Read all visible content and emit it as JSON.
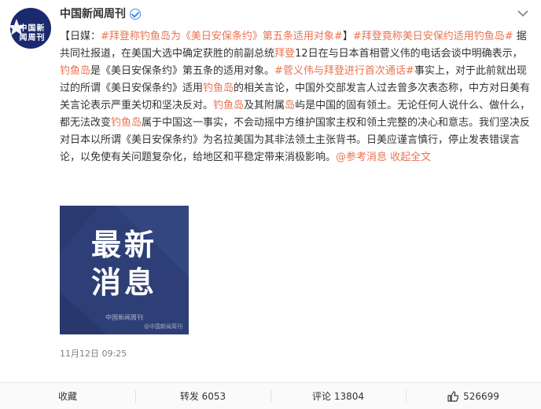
{
  "author": {
    "name": "中国新闻周刊",
    "avatar_text": "中国新闻周刊"
  },
  "post": {
    "segments": [
      {
        "text": "【日媒：",
        "style": "plain"
      },
      {
        "text": "#拜登称钓鱼岛为《美日安保条约》第五条适用对象#",
        "style": "tag"
      },
      {
        "text": "】",
        "style": "plain"
      },
      {
        "text": "#拜登竟称美日安保约适用钓鱼岛#",
        "style": "tag"
      },
      {
        "text": " 据共同社报道，在美国大选中确定获胜的前副总统",
        "style": "plain"
      },
      {
        "text": "拜登",
        "style": "hl"
      },
      {
        "text": "12日在与日本首相菅义伟的电话会谈中明确表示，",
        "style": "plain"
      },
      {
        "text": "钓鱼岛",
        "style": "hl"
      },
      {
        "text": "是《美日安保条约》第五条的适用对象。",
        "style": "plain"
      },
      {
        "text": "#菅义伟与拜登进行首次通话#",
        "style": "tag"
      },
      {
        "text": "事实上，对于此前就出现过的所谓《美日安保条约》适用",
        "style": "plain"
      },
      {
        "text": "钓鱼岛",
        "style": "hl"
      },
      {
        "text": "的相关言论，中国外交部发言人过去曾多次表态称，中方对日美有关言论表示严重关切和坚决反对。",
        "style": "plain"
      },
      {
        "text": "钓鱼岛",
        "style": "hl"
      },
      {
        "text": "及其附属",
        "style": "plain"
      },
      {
        "text": "岛",
        "style": "hl"
      },
      {
        "text": "屿是中国的固有领土。无论任何人说什么、做什么，都无法改变",
        "style": "plain"
      },
      {
        "text": "钓鱼岛",
        "style": "hl"
      },
      {
        "text": "属于中国这一事实，不会动摇中方维护国家主权和领土完整的决心和意志。我们坚决反对日本以所谓《美日安保条约》为名拉美国为其非法领土主张背书。日美应谨言慎行，停止发表错误言论，以免使有关问题复杂化，给地区和平稳定带来消极影响。",
        "style": "plain"
      },
      {
        "text": "@参考消息",
        "style": "tag"
      },
      {
        "text": " ",
        "style": "plain"
      },
      {
        "text": "收起全文",
        "style": "tag"
      }
    ],
    "image": {
      "title_line1": "最新",
      "title_line2": "消息",
      "badge": "中国新闻周刊",
      "watermark": "@中国新闻周刊"
    },
    "timestamp": "11月12日 09:25"
  },
  "footer": {
    "favorite_label": "收藏",
    "repost_label": "转发 6053",
    "comment_label": "评论 13804",
    "like_count": "526699"
  },
  "colors": {
    "accent": "#eb7350",
    "avatar_bg": "#1b2a6e",
    "image_bg": "#2e3f77",
    "verify_blue": "#3b8eed"
  }
}
